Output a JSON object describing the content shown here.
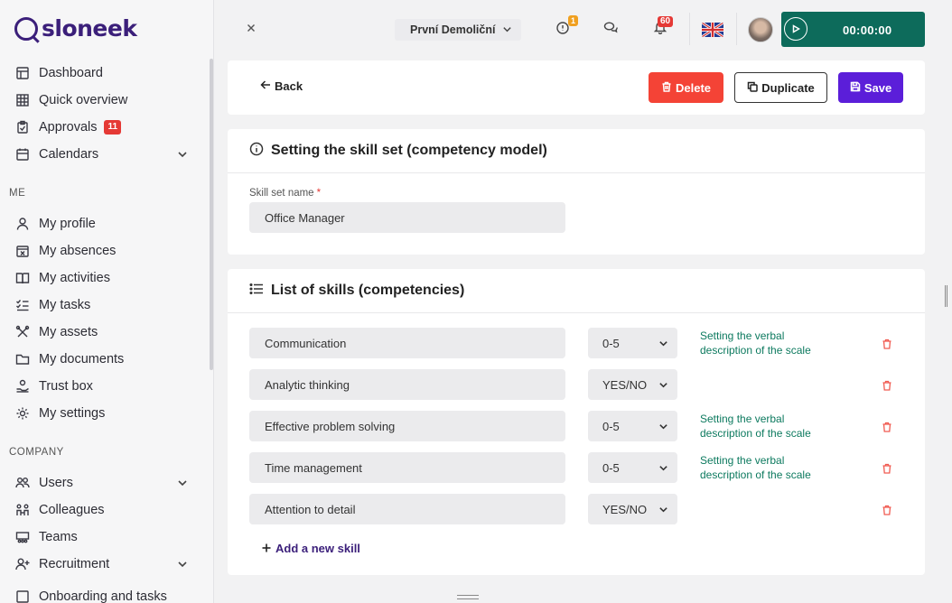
{
  "app": {
    "logo_text": "sloneek"
  },
  "sidebar": {
    "items_top": [
      {
        "label": "Dashboard",
        "icon": "dashboard-icon"
      },
      {
        "label": "Quick overview",
        "icon": "grid-icon"
      },
      {
        "label": "Approvals",
        "icon": "clipboard-icon",
        "badge": "11"
      },
      {
        "label": "Calendars",
        "icon": "calendar-icon",
        "expandable": true
      }
    ],
    "section_me": "ME",
    "items_me": [
      {
        "label": "My profile",
        "icon": "user-icon"
      },
      {
        "label": "My absences",
        "icon": "calendar-x-icon"
      },
      {
        "label": "My activities",
        "icon": "book-icon"
      },
      {
        "label": "My tasks",
        "icon": "checklist-icon"
      },
      {
        "label": "My assets",
        "icon": "tools-icon"
      },
      {
        "label": "My documents",
        "icon": "folder-icon"
      },
      {
        "label": "Trust box",
        "icon": "hand-icon"
      },
      {
        "label": "My settings",
        "icon": "gear-icon"
      }
    ],
    "section_company": "COMPANY",
    "items_company": [
      {
        "label": "Users",
        "icon": "users-icon",
        "expandable": true
      },
      {
        "label": "Colleagues",
        "icon": "colleagues-icon"
      },
      {
        "label": "Teams",
        "icon": "teams-icon"
      },
      {
        "label": "Recruitment",
        "icon": "user-plus-icon",
        "expandable": true
      },
      {
        "label": "Onboarding and tasks",
        "icon": "onboarding-icon"
      }
    ]
  },
  "topbar": {
    "company": "První Demoliční",
    "alerts_badge": "1",
    "notifications_badge": "60",
    "timer": "00:00:00",
    "colors": {
      "timer_bg": "#0d6b5b",
      "alert_badge": "#f0a020",
      "notif_badge": "#e53935"
    }
  },
  "actions": {
    "back": "Back",
    "delete": "Delete",
    "duplicate": "Duplicate",
    "save": "Save",
    "colors": {
      "delete": "#f44336",
      "save": "#5b1ed9"
    }
  },
  "skill_set": {
    "title": "Setting the skill set (competency model)",
    "name_label": "Skill set name",
    "required_mark": "*",
    "name_value": "Office Manager"
  },
  "skills": {
    "title": "List of skills (competencies)",
    "rows": [
      {
        "name": "Communication",
        "scale": "0-5",
        "link": "Setting the verbal description of the scale"
      },
      {
        "name": "Analytic thinking",
        "scale": "YES/NO",
        "link": ""
      },
      {
        "name": "Effective problem solving",
        "scale": "0-5",
        "link": "Setting the verbal description of the scale"
      },
      {
        "name": "Time management",
        "scale": "0-5",
        "link": "Setting the verbal description of the scale"
      },
      {
        "name": "Attention to detail",
        "scale": "YES/NO",
        "link": ""
      }
    ],
    "add_label": "Add a new skill"
  }
}
